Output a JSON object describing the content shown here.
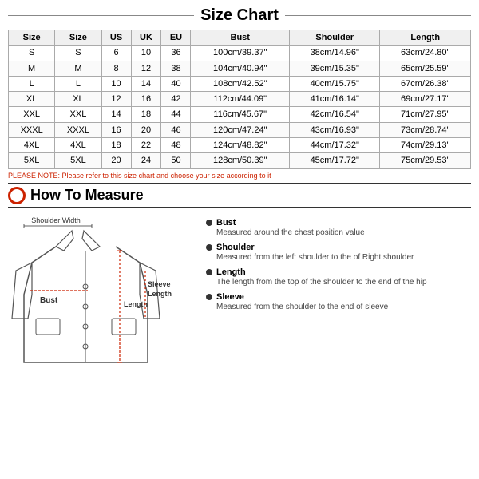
{
  "title": "Size Chart",
  "table": {
    "headers": [
      "Size",
      "Size",
      "US",
      "UK",
      "EU",
      "Bust",
      "Shoulder",
      "Length"
    ],
    "rows": [
      [
        "S",
        "S",
        "6",
        "10",
        "36",
        "100cm/39.37\"",
        "38cm/14.96\"",
        "63cm/24.80\""
      ],
      [
        "M",
        "M",
        "8",
        "12",
        "38",
        "104cm/40.94\"",
        "39cm/15.35\"",
        "65cm/25.59\""
      ],
      [
        "L",
        "L",
        "10",
        "14",
        "40",
        "108cm/42.52\"",
        "40cm/15.75\"",
        "67cm/26.38\""
      ],
      [
        "XL",
        "XL",
        "12",
        "16",
        "42",
        "112cm/44.09\"",
        "41cm/16.14\"",
        "69cm/27.17\""
      ],
      [
        "XXL",
        "XXL",
        "14",
        "18",
        "44",
        "116cm/45.67\"",
        "42cm/16.54\"",
        "71cm/27.95\""
      ],
      [
        "XXXL",
        "XXXL",
        "16",
        "20",
        "46",
        "120cm/47.24\"",
        "43cm/16.93\"",
        "73cm/28.74\""
      ],
      [
        "4XL",
        "4XL",
        "18",
        "22",
        "48",
        "124cm/48.82\"",
        "44cm/17.32\"",
        "74cm/29.13\""
      ],
      [
        "5XL",
        "5XL",
        "20",
        "24",
        "50",
        "128cm/50.39\"",
        "45cm/17.72\"",
        "75cm/29.53\""
      ]
    ]
  },
  "note": "PLEASE NOTE: Please refer to this size chart and choose your size according to it",
  "how_to_measure": {
    "title": "How To Measure",
    "items": [
      {
        "label": "Bust",
        "desc": "Measured around the chest position value"
      },
      {
        "label": "Shoulder",
        "desc": "Measured from the left shoulder to the of Right shoulder"
      },
      {
        "label": "Length",
        "desc": "The length from the top of the shoulder to the end of the hip"
      },
      {
        "label": "Sleeve",
        "desc": "Measured from the shoulder to the end of sleeve"
      }
    ]
  },
  "jacket_labels": {
    "shoulder_width": "Shoulder Width",
    "bust": "Bust",
    "sleeve_length": "Sleeve\nLength",
    "length": "Length"
  }
}
